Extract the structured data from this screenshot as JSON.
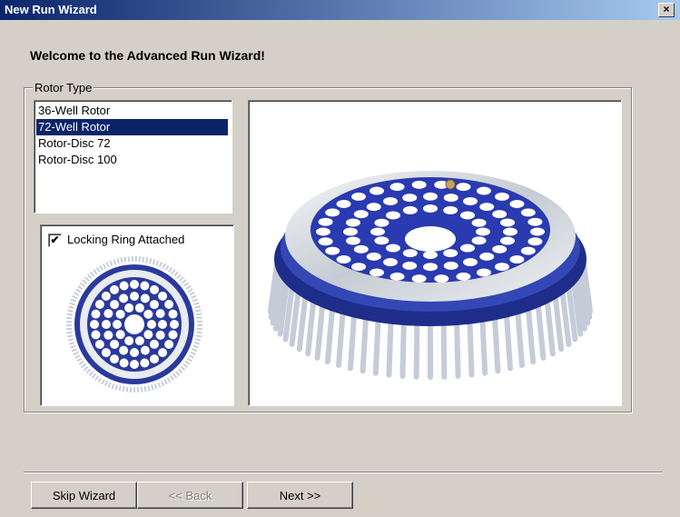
{
  "window": {
    "title": "New Run Wizard",
    "close_label": "×"
  },
  "heading": "Welcome to the Advanced Run Wizard!",
  "rotor_type": {
    "legend": "Rotor Type",
    "items": [
      "36-Well Rotor",
      "72-Well Rotor",
      "Rotor-Disc 72",
      "Rotor-Disc 100"
    ],
    "selected": "72-Well Rotor"
  },
  "locking_ring": {
    "label": "Locking Ring Attached",
    "checked": true,
    "check_glyph": "✔"
  },
  "buttons": {
    "skip": "Skip Wizard",
    "back": "<< Back",
    "next": "Next >>"
  },
  "colors": {
    "title_start": "#0a246a",
    "title_end": "#a6caf0",
    "rotor_blue": "#2a3a9c",
    "selection": "#0a246a"
  }
}
